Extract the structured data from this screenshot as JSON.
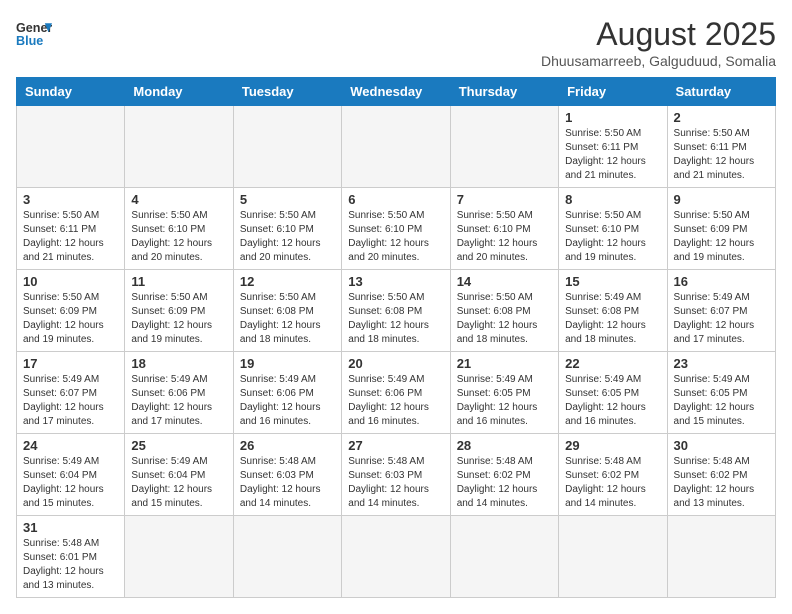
{
  "logo": {
    "line1": "General",
    "line2": "Blue"
  },
  "title": "August 2025",
  "subtitle": "Dhuusamarreeb, Galguduud, Somalia",
  "weekdays": [
    "Sunday",
    "Monday",
    "Tuesday",
    "Wednesday",
    "Thursday",
    "Friday",
    "Saturday"
  ],
  "weeks": [
    [
      {
        "day": "",
        "info": ""
      },
      {
        "day": "",
        "info": ""
      },
      {
        "day": "",
        "info": ""
      },
      {
        "day": "",
        "info": ""
      },
      {
        "day": "",
        "info": ""
      },
      {
        "day": "1",
        "info": "Sunrise: 5:50 AM\nSunset: 6:11 PM\nDaylight: 12 hours and 21 minutes."
      },
      {
        "day": "2",
        "info": "Sunrise: 5:50 AM\nSunset: 6:11 PM\nDaylight: 12 hours and 21 minutes."
      }
    ],
    [
      {
        "day": "3",
        "info": "Sunrise: 5:50 AM\nSunset: 6:11 PM\nDaylight: 12 hours and 21 minutes."
      },
      {
        "day": "4",
        "info": "Sunrise: 5:50 AM\nSunset: 6:10 PM\nDaylight: 12 hours and 20 minutes."
      },
      {
        "day": "5",
        "info": "Sunrise: 5:50 AM\nSunset: 6:10 PM\nDaylight: 12 hours and 20 minutes."
      },
      {
        "day": "6",
        "info": "Sunrise: 5:50 AM\nSunset: 6:10 PM\nDaylight: 12 hours and 20 minutes."
      },
      {
        "day": "7",
        "info": "Sunrise: 5:50 AM\nSunset: 6:10 PM\nDaylight: 12 hours and 20 minutes."
      },
      {
        "day": "8",
        "info": "Sunrise: 5:50 AM\nSunset: 6:10 PM\nDaylight: 12 hours and 19 minutes."
      },
      {
        "day": "9",
        "info": "Sunrise: 5:50 AM\nSunset: 6:09 PM\nDaylight: 12 hours and 19 minutes."
      }
    ],
    [
      {
        "day": "10",
        "info": "Sunrise: 5:50 AM\nSunset: 6:09 PM\nDaylight: 12 hours and 19 minutes."
      },
      {
        "day": "11",
        "info": "Sunrise: 5:50 AM\nSunset: 6:09 PM\nDaylight: 12 hours and 19 minutes."
      },
      {
        "day": "12",
        "info": "Sunrise: 5:50 AM\nSunset: 6:08 PM\nDaylight: 12 hours and 18 minutes."
      },
      {
        "day": "13",
        "info": "Sunrise: 5:50 AM\nSunset: 6:08 PM\nDaylight: 12 hours and 18 minutes."
      },
      {
        "day": "14",
        "info": "Sunrise: 5:50 AM\nSunset: 6:08 PM\nDaylight: 12 hours and 18 minutes."
      },
      {
        "day": "15",
        "info": "Sunrise: 5:49 AM\nSunset: 6:08 PM\nDaylight: 12 hours and 18 minutes."
      },
      {
        "day": "16",
        "info": "Sunrise: 5:49 AM\nSunset: 6:07 PM\nDaylight: 12 hours and 17 minutes."
      }
    ],
    [
      {
        "day": "17",
        "info": "Sunrise: 5:49 AM\nSunset: 6:07 PM\nDaylight: 12 hours and 17 minutes."
      },
      {
        "day": "18",
        "info": "Sunrise: 5:49 AM\nSunset: 6:06 PM\nDaylight: 12 hours and 17 minutes."
      },
      {
        "day": "19",
        "info": "Sunrise: 5:49 AM\nSunset: 6:06 PM\nDaylight: 12 hours and 16 minutes."
      },
      {
        "day": "20",
        "info": "Sunrise: 5:49 AM\nSunset: 6:06 PM\nDaylight: 12 hours and 16 minutes."
      },
      {
        "day": "21",
        "info": "Sunrise: 5:49 AM\nSunset: 6:05 PM\nDaylight: 12 hours and 16 minutes."
      },
      {
        "day": "22",
        "info": "Sunrise: 5:49 AM\nSunset: 6:05 PM\nDaylight: 12 hours and 16 minutes."
      },
      {
        "day": "23",
        "info": "Sunrise: 5:49 AM\nSunset: 6:05 PM\nDaylight: 12 hours and 15 minutes."
      }
    ],
    [
      {
        "day": "24",
        "info": "Sunrise: 5:49 AM\nSunset: 6:04 PM\nDaylight: 12 hours and 15 minutes."
      },
      {
        "day": "25",
        "info": "Sunrise: 5:49 AM\nSunset: 6:04 PM\nDaylight: 12 hours and 15 minutes."
      },
      {
        "day": "26",
        "info": "Sunrise: 5:48 AM\nSunset: 6:03 PM\nDaylight: 12 hours and 14 minutes."
      },
      {
        "day": "27",
        "info": "Sunrise: 5:48 AM\nSunset: 6:03 PM\nDaylight: 12 hours and 14 minutes."
      },
      {
        "day": "28",
        "info": "Sunrise: 5:48 AM\nSunset: 6:02 PM\nDaylight: 12 hours and 14 minutes."
      },
      {
        "day": "29",
        "info": "Sunrise: 5:48 AM\nSunset: 6:02 PM\nDaylight: 12 hours and 14 minutes."
      },
      {
        "day": "30",
        "info": "Sunrise: 5:48 AM\nSunset: 6:02 PM\nDaylight: 12 hours and 13 minutes."
      }
    ],
    [
      {
        "day": "31",
        "info": "Sunrise: 5:48 AM\nSunset: 6:01 PM\nDaylight: 12 hours and 13 minutes."
      },
      {
        "day": "",
        "info": ""
      },
      {
        "day": "",
        "info": ""
      },
      {
        "day": "",
        "info": ""
      },
      {
        "day": "",
        "info": ""
      },
      {
        "day": "",
        "info": ""
      },
      {
        "day": "",
        "info": ""
      }
    ]
  ]
}
